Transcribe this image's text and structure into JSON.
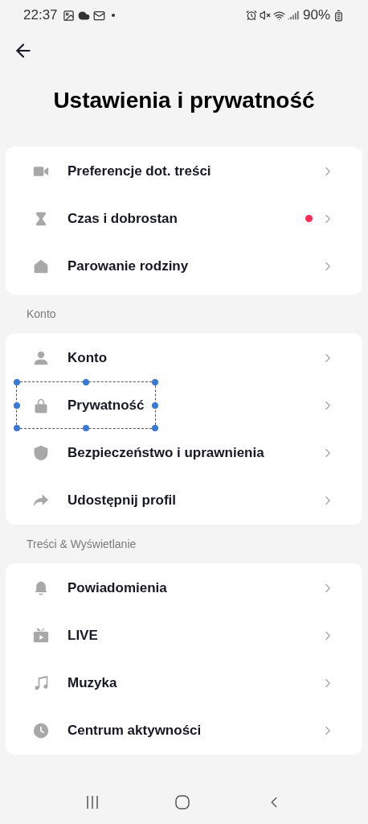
{
  "status_bar": {
    "time": "22:37",
    "battery": "90%"
  },
  "title": "Ustawienia i prywatność",
  "sections": [
    {
      "items": [
        {
          "kind": "video",
          "label": "Preferencje dot. treści",
          "dot": false,
          "framed": false
        },
        {
          "kind": "hourglass",
          "label": "Czas i dobrostan",
          "dot": true,
          "framed": false
        },
        {
          "kind": "house",
          "label": "Parowanie rodziny",
          "dot": false,
          "framed": false
        }
      ]
    },
    {
      "heading": "Konto",
      "items": [
        {
          "kind": "user",
          "label": "Konto",
          "dot": false,
          "framed": false
        },
        {
          "kind": "lock",
          "label": "Prywatność",
          "dot": false,
          "framed": true
        },
        {
          "kind": "shield",
          "label": "Bezpieczeństwo i uprawnienia",
          "dot": false,
          "framed": false
        },
        {
          "kind": "share",
          "label": "Udostępnij profil",
          "dot": false,
          "framed": false
        }
      ]
    },
    {
      "heading": "Treści & Wyświetlanie",
      "items": [
        {
          "kind": "bell",
          "label": "Powiadomienia",
          "dot": false,
          "framed": false
        },
        {
          "kind": "tv",
          "label": "LIVE",
          "dot": false,
          "framed": false
        },
        {
          "kind": "music",
          "label": "Muzyka",
          "dot": false,
          "framed": false
        },
        {
          "kind": "clock",
          "label": "Centrum aktywności",
          "dot": false,
          "framed": false
        }
      ]
    }
  ]
}
